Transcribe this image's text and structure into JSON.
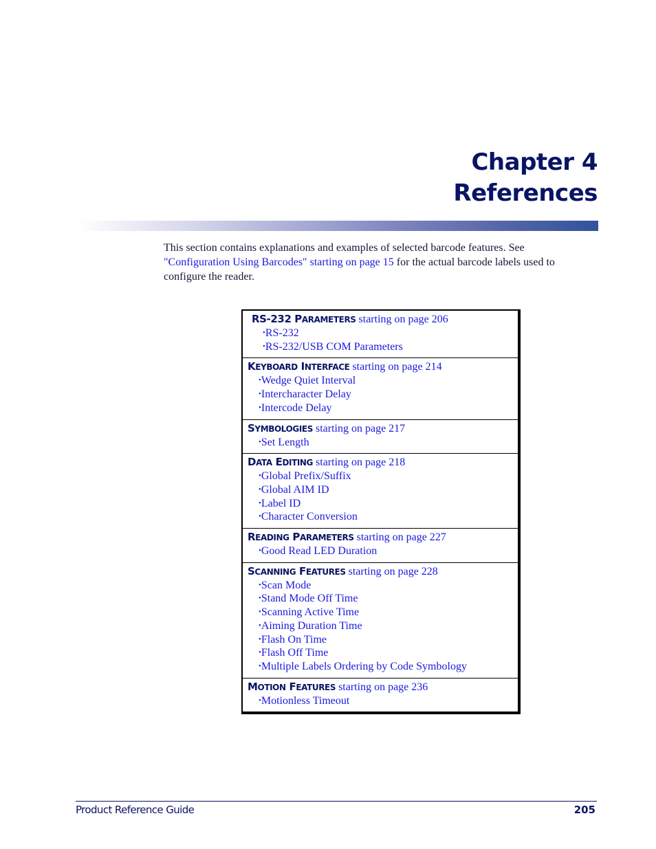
{
  "chapter": {
    "line1": "Chapter 4",
    "line2": "References"
  },
  "intro": {
    "text_before": "This section contains explanations and examples of selected barcode features. See ",
    "link": "\"Configuration Using Barcodes\" starting on page 15",
    "text_after": " for the actual barcode labels used to configure the reader."
  },
  "toc": {
    "sections": [
      {
        "title_cap": "RS-232 P",
        "title_small": "ARAMETERS",
        "link": "starting on page 206",
        "items": [
          "RS-232",
          "RS-232/USB COM Parameters"
        ]
      },
      {
        "title_cap": "K",
        "title_small": "EYBOARD",
        "title_cap2": " I",
        "title_small2": "NTERFACE",
        "link": "starting on page 214",
        "items": [
          "Wedge Quiet Interval",
          "Intercharacter Delay",
          "Intercode Delay"
        ]
      },
      {
        "title_cap": "S",
        "title_small": "YMBOLOGIES",
        "link": "starting on page 217",
        "items": [
          "Set Length"
        ]
      },
      {
        "title_cap": "D",
        "title_small": "ATA",
        "title_cap2": " E",
        "title_small2": "DITING",
        "link": "starting on page 218",
        "items": [
          "Global Prefix/Suffix",
          "Global AIM ID",
          "Label ID",
          "Character Conversion"
        ]
      },
      {
        "title_cap": "R",
        "title_small": "EADING",
        "title_cap2": " P",
        "title_small2": "ARAMETERS",
        "link": "starting on page 227",
        "items": [
          "Good Read LED Duration"
        ]
      },
      {
        "title_cap": "S",
        "title_small": "CANNING",
        "title_cap2": " F",
        "title_small2": "EATURES",
        "link": "starting on page 228",
        "items": [
          "Scan Mode",
          "Stand Mode Off Time",
          "Scanning Active Time",
          "Aiming Duration Time",
          "Flash On Time",
          "Flash Off Time",
          "Multiple Labels Ordering by Code Symbology"
        ]
      },
      {
        "title_cap": "M",
        "title_small": "OTION",
        "title_cap2": " F",
        "title_small2": "EATURES",
        "link": "starting on page 236",
        "items": [
          "Motionless Timeout"
        ]
      }
    ],
    "bullet": "•"
  },
  "footer": {
    "title": "Product Reference Guide",
    "page_number": "205"
  }
}
